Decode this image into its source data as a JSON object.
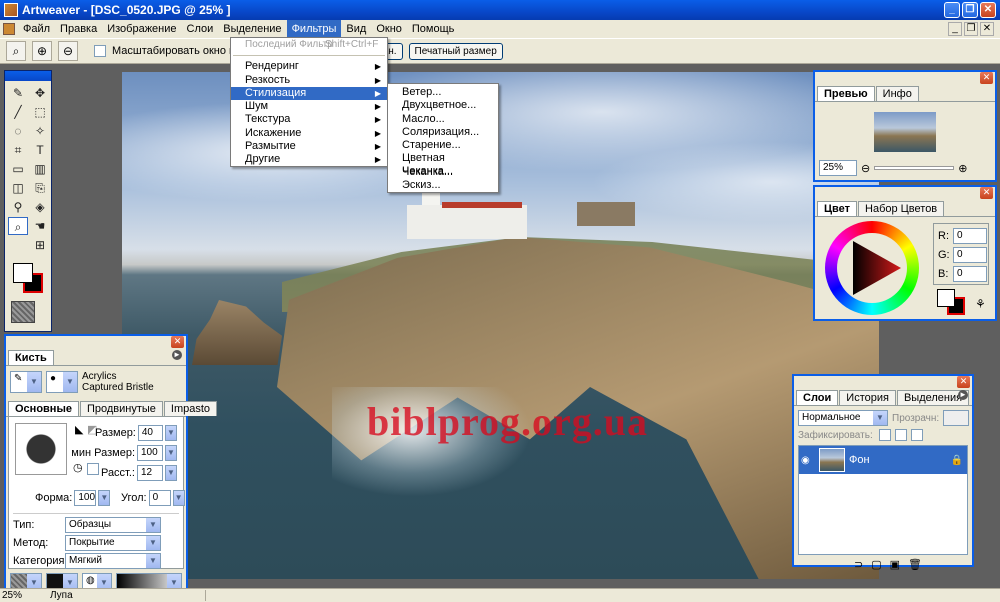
{
  "window": {
    "title": "Artweaver - [DSC_0520.JPG @ 25% ]"
  },
  "menu": {
    "items": [
      "Файл",
      "Правка",
      "Изображение",
      "Слои",
      "Выделение",
      "Фильтры",
      "Вид",
      "Окно",
      "Помощь"
    ],
    "active_index": 5
  },
  "options_bar": {
    "zoom_checkbox_label": "Масштабировать окно под изо",
    "fit_button": "онка в экран.",
    "print_size_button": "Печатный размер"
  },
  "filters_menu": {
    "last_filter": "Последний Фильтр",
    "last_filter_shortcut": "Shift+Ctrl+F",
    "items": [
      "Рендеринг",
      "Резкость",
      "Стилизация",
      "Шум",
      "Текстура",
      "Искажение",
      "Размытие",
      "Другие"
    ],
    "highlighted_index": 2
  },
  "stylize_submenu": {
    "items": [
      "Ветер...",
      "Двухцветное...",
      "Масло...",
      "Соляризация...",
      "Старение...",
      "Цветная Чеканка...",
      "Чеканка...",
      "Эскиз..."
    ]
  },
  "canvas": {
    "watermark": "biblprog.org.ua"
  },
  "preview_panel": {
    "tabs": [
      "Превью",
      "Инфо"
    ],
    "zoom": "25%"
  },
  "color_panel": {
    "tabs": [
      "Цвет",
      "Набор Цветов"
    ],
    "r_label": "R:",
    "g_label": "G:",
    "b_label": "B:",
    "r": "0",
    "g": "0",
    "b": "0"
  },
  "layers_panel": {
    "tabs": [
      "Слои",
      "История",
      "Выделения"
    ],
    "blend_mode": "Нормальное",
    "opacity_label": "Прозрачн:",
    "lock_label": "Зафиксировать:",
    "layers": [
      {
        "name": "Фон"
      }
    ]
  },
  "brush_panel": {
    "title": "Кисть",
    "brush_name_line1": "Acrylics",
    "brush_name_line2": "Captured Bristle",
    "tabs": [
      "Основные",
      "Продвинутые",
      "Impasto"
    ],
    "size_label": "Размер:",
    "size": "40",
    "min_size_label": "мин Размер:",
    "min_size": "100",
    "spacing_label": "Расст.:",
    "spacing": "12",
    "shape_label": "Форма:",
    "shape": "100",
    "angle_label": "Угол:",
    "angle": "0",
    "type_label": "Тип:",
    "type": "Образцы",
    "method_label": "Метод:",
    "method": "Покрытие",
    "category_label": "Категория:",
    "category": "Мягкий"
  },
  "status_bar": {
    "zoom": "25%",
    "tool": "Лупа"
  },
  "colors": {
    "accent": "#316ac5",
    "title_blue": "#0a5ee8"
  }
}
